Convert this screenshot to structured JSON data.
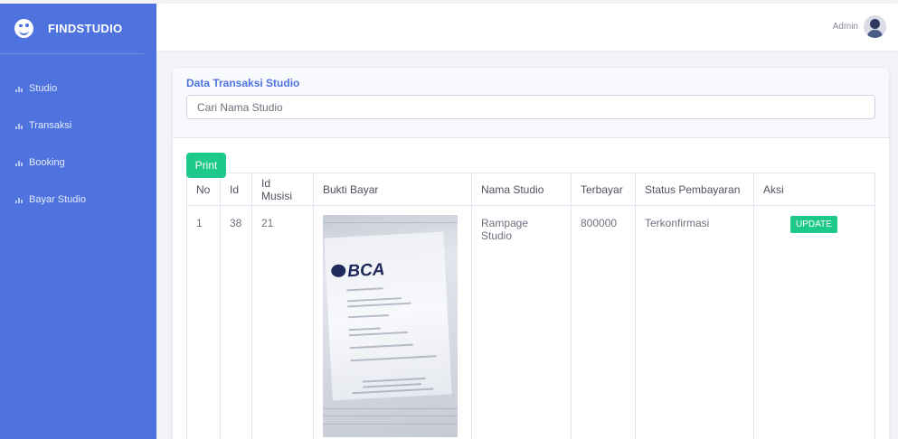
{
  "brand": {
    "name": "FINDSTUDIO"
  },
  "sidebar": {
    "items": [
      {
        "label": "Studio"
      },
      {
        "label": "Transaksi"
      },
      {
        "label": "Booking"
      },
      {
        "label": "Bayar Studio"
      }
    ]
  },
  "topbar": {
    "user_name": "Admin"
  },
  "card": {
    "title": "Data Transaksi Studio",
    "search_placeholder": "Cari Nama Studio",
    "print_label": "Print"
  },
  "table": {
    "headers": [
      "No",
      "Id",
      "Id Musisi",
      "Bukti Bayar",
      "Nama Studio",
      "Terbayar",
      "Status Pembayaran",
      "Aksi"
    ],
    "rows": [
      {
        "no": "1",
        "id": "38",
        "id_musisi": "21",
        "nama_studio": "Rampage Studio",
        "terbayar": "800000",
        "status": "Terkonfirmasi",
        "action_label": "UPDATE"
      }
    ]
  },
  "receipt": {
    "bank_logo_text": "BCA"
  }
}
